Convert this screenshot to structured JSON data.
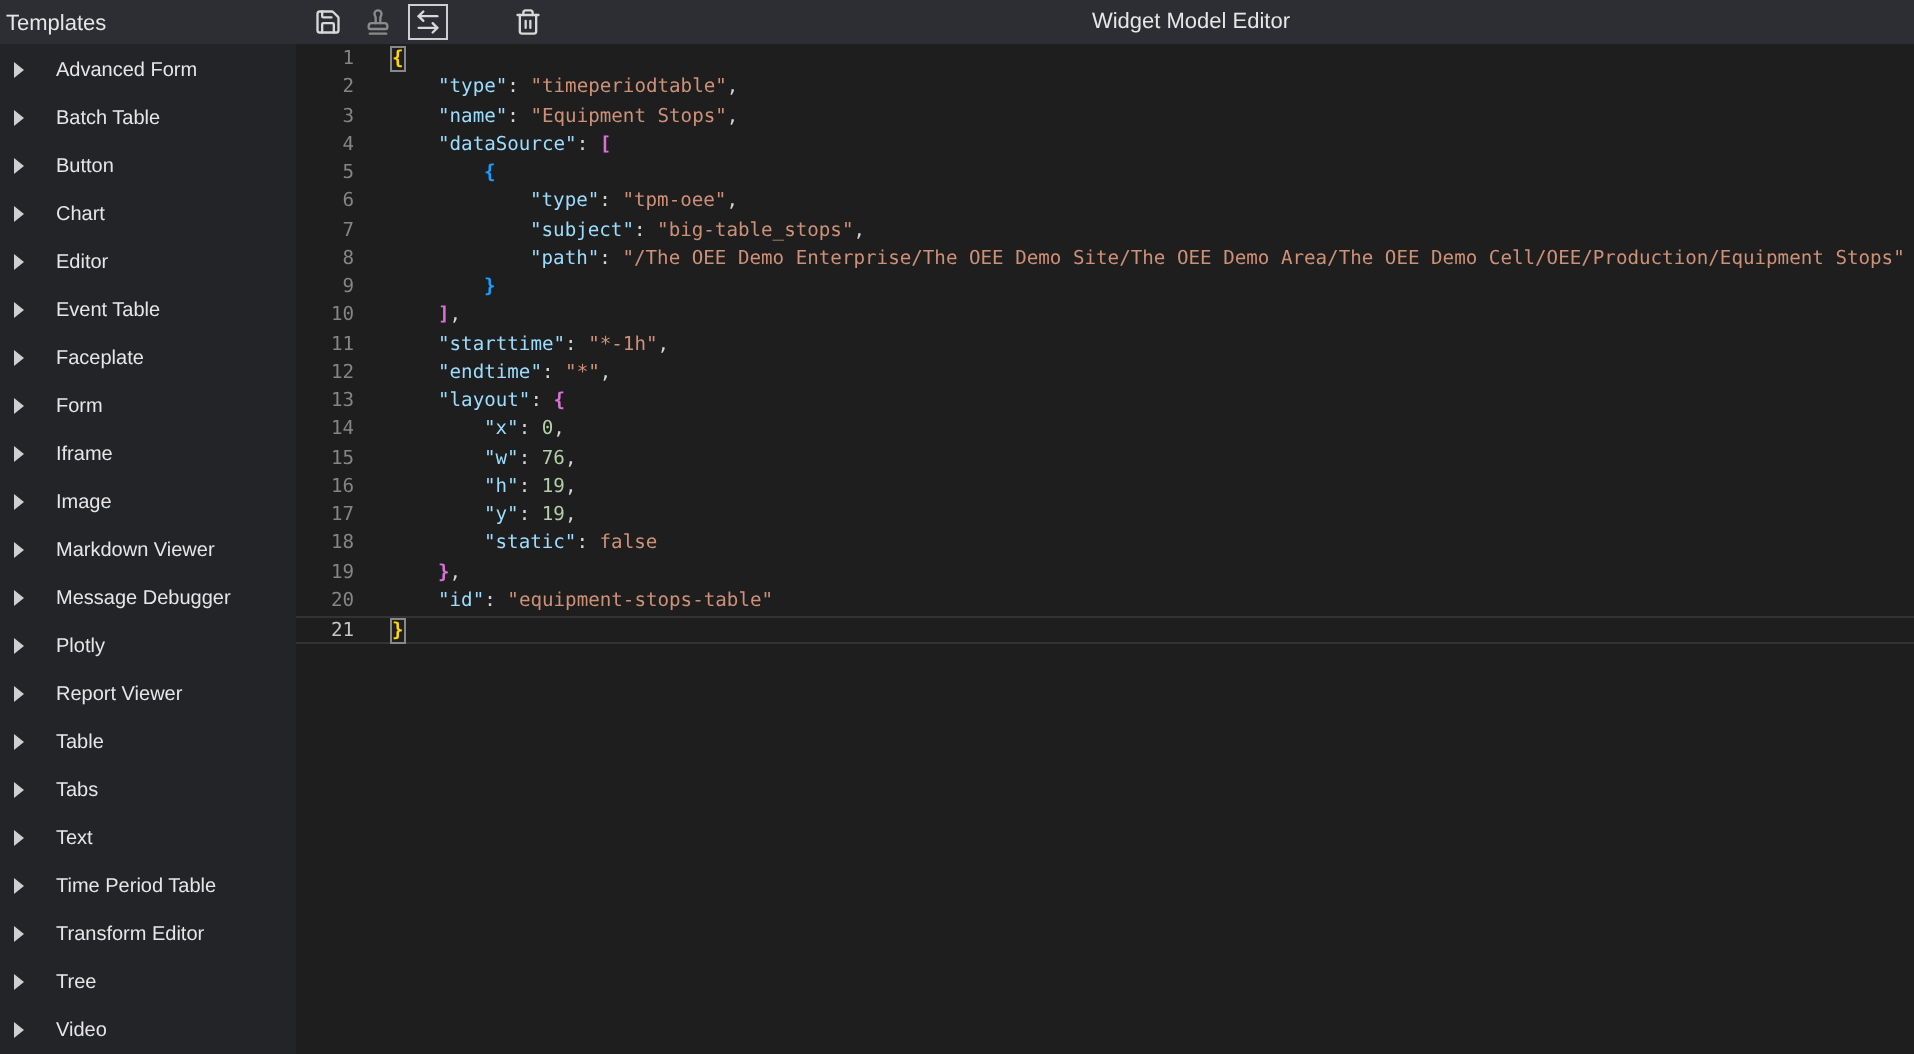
{
  "sidebar": {
    "title": "Templates",
    "items": [
      {
        "label": "Advanced Form",
        "expanded": false
      },
      {
        "label": "Batch Table",
        "expanded": false
      },
      {
        "label": "Button",
        "expanded": false
      },
      {
        "label": "Chart",
        "expanded": false
      },
      {
        "label": "Editor",
        "expanded": false
      },
      {
        "label": "Event Table",
        "expanded": false
      },
      {
        "label": "Faceplate",
        "expanded": false
      },
      {
        "label": "Form",
        "expanded": false
      },
      {
        "label": "Iframe",
        "expanded": false
      },
      {
        "label": "Image",
        "expanded": false
      },
      {
        "label": "Markdown Viewer",
        "expanded": false
      },
      {
        "label": "Message Debugger",
        "expanded": false
      },
      {
        "label": "Plotly",
        "expanded": false
      },
      {
        "label": "Report Viewer",
        "expanded": false
      },
      {
        "label": "Table",
        "expanded": false
      },
      {
        "label": "Tabs",
        "expanded": false
      },
      {
        "label": "Text",
        "expanded": false
      },
      {
        "label": "Time Period Table",
        "expanded": false
      },
      {
        "label": "Transform Editor",
        "expanded": false
      },
      {
        "label": "Tree",
        "expanded": false
      },
      {
        "label": "Video",
        "expanded": false
      }
    ]
  },
  "toolbar": {
    "title": "Widget Model Editor",
    "buttons": [
      {
        "kind": "save",
        "disabled": false
      },
      {
        "kind": "stamp",
        "disabled": true
      },
      {
        "kind": "swap",
        "disabled": false
      },
      {
        "kind": "delete",
        "disabled": false
      }
    ]
  },
  "editor": {
    "lines": [
      {
        "number": "1",
        "selected": false,
        "tokens": [
          {
            "kind": "bracket",
            "text": "{",
            "color": "#ffd700"
          }
        ],
        "children": [
          {
            "number": "2",
            "selected": false,
            "tokens": [
              {
                "kind": "key",
                "text": "\"type\""
              },
              {
                "kind": "plain",
                "text": ": "
              },
              {
                "kind": "string",
                "text": "\"timeperiodtable\""
              },
              {
                "kind": "plain",
                "text": ","
              }
            ]
          },
          {
            "number": "3",
            "selected": false,
            "tokens": [
              {
                "kind": "key",
                "text": "\"name\""
              },
              {
                "kind": "plain",
                "text": ": "
              },
              {
                "kind": "string",
                "text": "\"Equipment Stops\""
              },
              {
                "kind": "plain",
                "text": ","
              }
            ]
          },
          {
            "number": "4",
            "selected": false,
            "tokens": [
              {
                "kind": "key",
                "text": "\"dataSource\""
              },
              {
                "kind": "plain",
                "text": ": "
              },
              {
                "kind": "bracket",
                "text": "[",
                "color": "#da70d6"
              }
            ],
            "children": [
              {
                "number": "5",
                "selected": false,
                "tokens": [
                  {
                    "kind": "bracket",
                    "text": "{",
                    "color": "#179fff"
                  }
                ],
                "children": [
                  {
                    "number": "6",
                    "selected": false,
                    "tokens": [
                      {
                        "kind": "key",
                        "text": "\"type\""
                      },
                      {
                        "kind": "plain",
                        "text": ": "
                      },
                      {
                        "kind": "string",
                        "text": "\"tpm-oee\""
                      },
                      {
                        "kind": "plain",
                        "text": ","
                      }
                    ]
                  },
                  {
                    "number": "7",
                    "selected": false,
                    "tokens": [
                      {
                        "kind": "key",
                        "text": "\"subject\""
                      },
                      {
                        "kind": "plain",
                        "text": ": "
                      },
                      {
                        "kind": "string",
                        "text": "\"big-table_stops\""
                      },
                      {
                        "kind": "plain",
                        "text": ","
                      }
                    ]
                  },
                  {
                    "number": "8",
                    "selected": false,
                    "tokens": [
                      {
                        "kind": "key",
                        "text": "\"path\""
                      },
                      {
                        "kind": "plain",
                        "text": ": "
                      },
                      {
                        "kind": "string",
                        "text": "\"/The OEE Demo Enterprise/The OEE Demo Site/The OEE Demo Area/The OEE Demo Cell/OEE/Production/Equipment Stops\""
                      }
                    ]
                  }
                ]
              },
              {
                "number": "9",
                "selected": false,
                "tokens": [
                  {
                    "kind": "bracket",
                    "text": "}",
                    "color": "#179fff"
                  }
                ]
              }
            ]
          },
          {
            "number": "10",
            "selected": false,
            "tokens": [
              {
                "kind": "bracket",
                "text": "]",
                "color": "#da70d6"
              },
              {
                "kind": "plain",
                "text": ","
              }
            ]
          },
          {
            "number": "11",
            "selected": false,
            "tokens": [
              {
                "kind": "key",
                "text": "\"starttime\""
              },
              {
                "kind": "plain",
                "text": ": "
              },
              {
                "kind": "string",
                "text": "\"*-1h\""
              },
              {
                "kind": "plain",
                "text": ","
              }
            ]
          },
          {
            "number": "12",
            "selected": false,
            "tokens": [
              {
                "kind": "key",
                "text": "\"endtime\""
              },
              {
                "kind": "plain",
                "text": ": "
              },
              {
                "kind": "string",
                "text": "\"*\""
              },
              {
                "kind": "plain",
                "text": ","
              }
            ]
          },
          {
            "number": "13",
            "selected": false,
            "tokens": [
              {
                "kind": "key",
                "text": "\"layout\""
              },
              {
                "kind": "plain",
                "text": ": "
              },
              {
                "kind": "bracket",
                "text": "{",
                "color": "#da70d6"
              }
            ],
            "children": [
              {
                "number": "14",
                "selected": false,
                "tokens": [
                  {
                    "kind": "key",
                    "text": "\"x\""
                  },
                  {
                    "kind": "plain",
                    "text": ": "
                  },
                  {
                    "kind": "number",
                    "text": "0"
                  },
                  {
                    "kind": "plain",
                    "text": ","
                  }
                ]
              },
              {
                "number": "15",
                "selected": false,
                "tokens": [
                  {
                    "kind": "key",
                    "text": "\"w\""
                  },
                  {
                    "kind": "plain",
                    "text": ": "
                  },
                  {
                    "kind": "number",
                    "text": "76"
                  },
                  {
                    "kind": "plain",
                    "text": ","
                  }
                ]
              },
              {
                "number": "16",
                "selected": false,
                "tokens": [
                  {
                    "kind": "key",
                    "text": "\"h\""
                  },
                  {
                    "kind": "plain",
                    "text": ": "
                  },
                  {
                    "kind": "number",
                    "text": "19"
                  },
                  {
                    "kind": "plain",
                    "text": ","
                  }
                ]
              },
              {
                "number": "17",
                "selected": false,
                "tokens": [
                  {
                    "kind": "key",
                    "text": "\"y\""
                  },
                  {
                    "kind": "plain",
                    "text": ": "
                  },
                  {
                    "kind": "number",
                    "text": "19"
                  },
                  {
                    "kind": "plain",
                    "text": ","
                  }
                ]
              },
              {
                "number": "18",
                "selected": false,
                "tokens": [
                  {
                    "kind": "key",
                    "text": "\"static\""
                  },
                  {
                    "kind": "plain",
                    "text": ": "
                  },
                  {
                    "kind": "keyword",
                    "text": "false"
                  }
                ]
              }
            ]
          },
          {
            "number": "19",
            "selected": false,
            "tokens": [
              {
                "kind": "bracket",
                "text": "}",
                "color": "#da70d6"
              },
              {
                "kind": "plain",
                "text": ","
              }
            ]
          },
          {
            "number": "20",
            "selected": false,
            "tokens": [
              {
                "kind": "key",
                "text": "\"id\""
              },
              {
                "kind": "plain",
                "text": ": "
              },
              {
                "kind": "string",
                "text": "\"equipment-stops-table\""
              }
            ]
          }
        ]
      },
      {
        "number": "21",
        "selected": true,
        "tokens": [
          {
            "kind": "bracket",
            "text": "}",
            "color": "#ffd700"
          }
        ]
      }
    ]
  }
}
